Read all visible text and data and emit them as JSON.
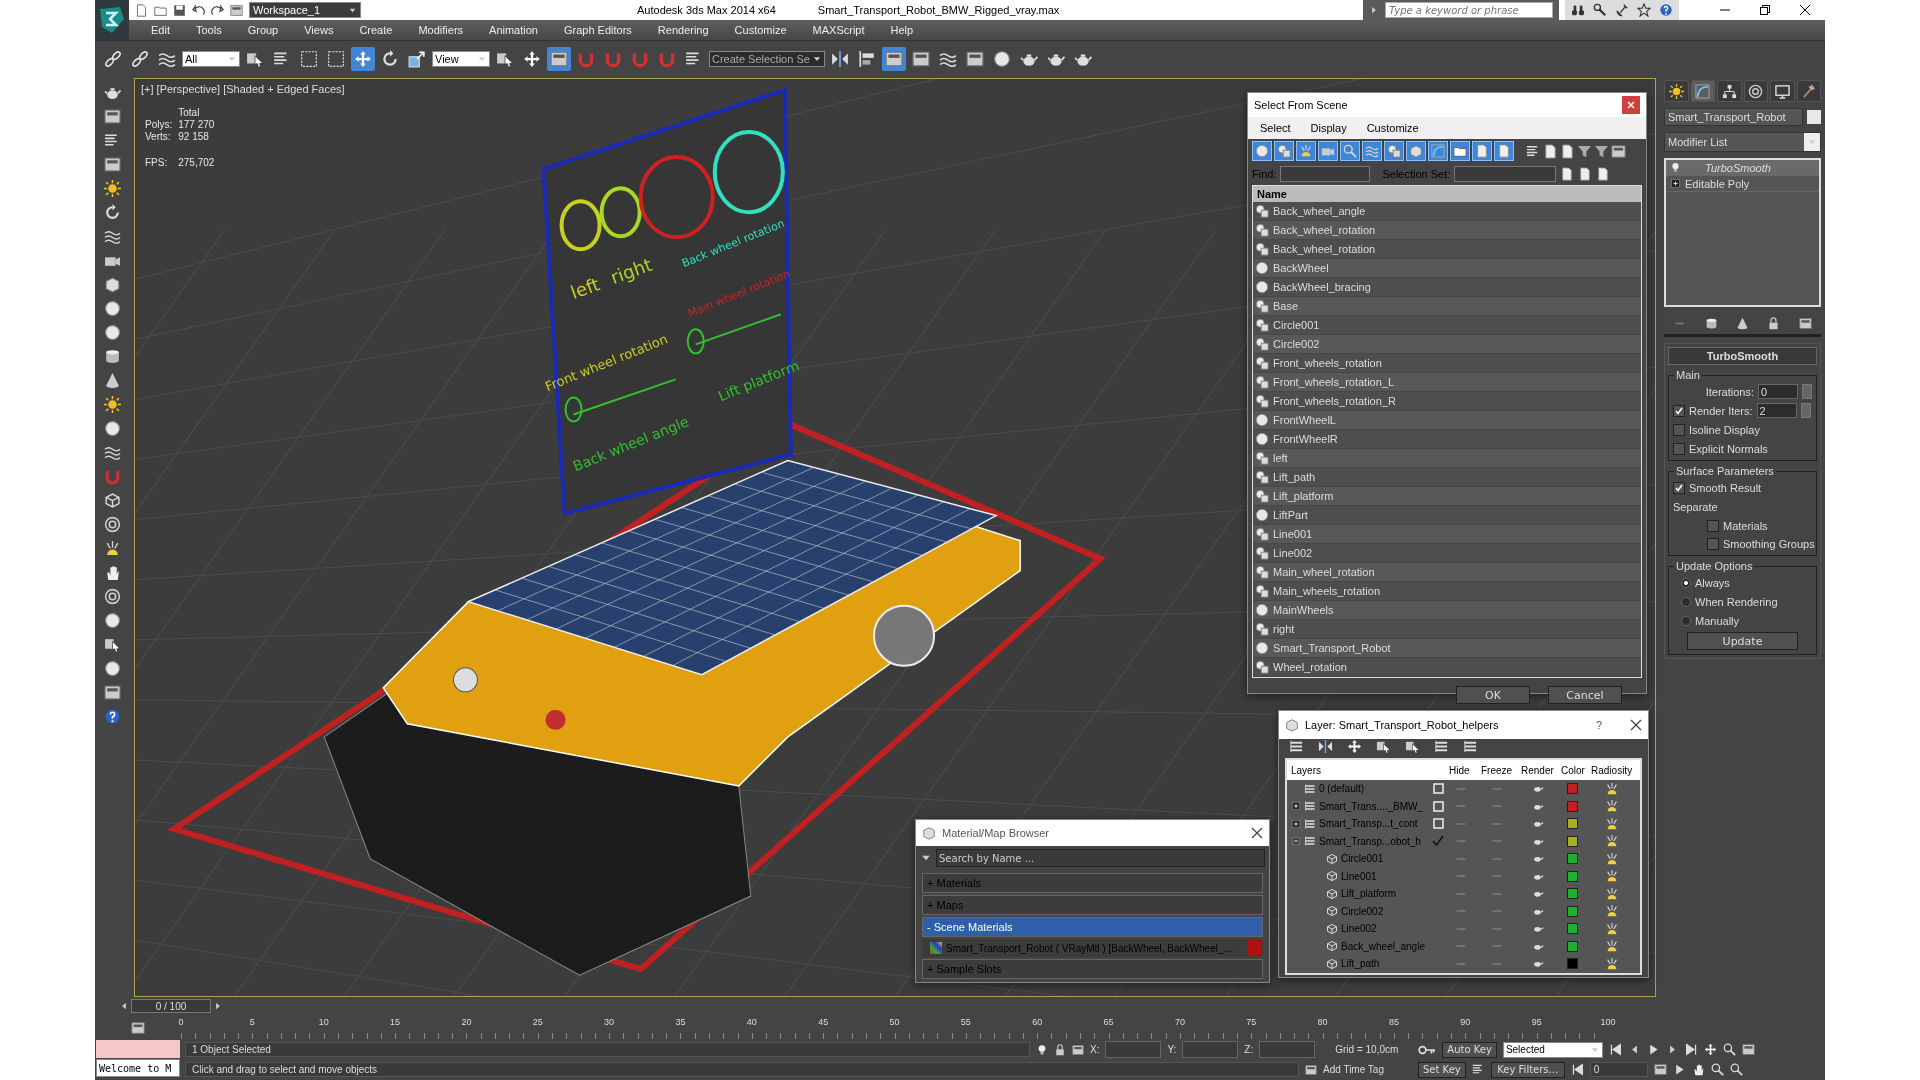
{
  "title_bar": {
    "workspace": "Workspace_1",
    "app": "Autodesk 3ds Max  2014 x64",
    "file": "Smart_Transport_Robot_BMW_Rigged_vray.max",
    "search": {
      "placeholder": "Type a keyword or phrase"
    }
  },
  "menu": [
    "Edit",
    "Tools",
    "Group",
    "Views",
    "Create",
    "Modifiers",
    "Animation",
    "Graph Editors",
    "Rendering",
    "Customize",
    "MAXScript",
    "Help"
  ],
  "toolbar": [
    {
      "kind": "button",
      "selected": false
    },
    {
      "kind": "button",
      "selected": false
    },
    {
      "kind": "button",
      "selected": false
    },
    {
      "kind": "dropdown",
      "value": "All"
    },
    {
      "kind": "button",
      "selected": false
    },
    {
      "kind": "button",
      "selected": false
    },
    {
      "kind": "button",
      "selected": false
    },
    {
      "kind": "button",
      "selected": false
    },
    {
      "kind": "button",
      "selected": true
    },
    {
      "kind": "button",
      "selected": false
    },
    {
      "kind": "button",
      "selected": false
    },
    {
      "kind": "dropdown",
      "value": "View"
    },
    {
      "kind": "button",
      "selected": false
    },
    {
      "kind": "button",
      "selected": false
    },
    {
      "kind": "button",
      "selected": true
    },
    {
      "kind": "button",
      "selected": false
    },
    {
      "kind": "button",
      "selected": false
    },
    {
      "kind": "button",
      "selected": false
    },
    {
      "kind": "button",
      "selected": false
    },
    {
      "kind": "button",
      "selected": false
    },
    {
      "kind": "dropdown",
      "value": "Create Selection Se"
    },
    {
      "kind": "button",
      "selected": false
    },
    {
      "kind": "button",
      "selected": false
    },
    {
      "kind": "button",
      "selected": true
    },
    {
      "kind": "button",
      "selected": false
    },
    {
      "kind": "button",
      "selected": false
    },
    {
      "kind": "button",
      "selected": false
    },
    {
      "kind": "button",
      "selected": false
    },
    {
      "kind": "button",
      "selected": false
    },
    {
      "kind": "button",
      "selected": false
    },
    {
      "kind": "button",
      "selected": false
    }
  ],
  "viewport": {
    "label": "[+] [Perspective] [Shaded + Edged Faces]",
    "stats_header": "Total",
    "stats": [
      {
        "label": "Polys:",
        "value": "177 270"
      },
      {
        "label": "Verts:",
        "value": "92 158"
      },
      {
        "label": "FPS:",
        "value": "275,702"
      }
    ],
    "board_labels": [
      {
        "text": "left",
        "color": "#c8d020"
      },
      {
        "text": "right",
        "color": "#a8d820"
      },
      {
        "text": "Front wheel rotation",
        "color": "#c8d020"
      },
      {
        "text": "Main wheel rotation",
        "color": "#d02020"
      },
      {
        "text": "Back wheel rotation",
        "color": "#30e0c0"
      },
      {
        "text": "Lift platform",
        "color": "#30c030"
      },
      {
        "text": "Back wheel angle",
        "color": "#30c030"
      }
    ]
  },
  "command_panel": {
    "tabs": [
      {
        "selected": false
      },
      {
        "selected": true
      },
      {
        "selected": false
      },
      {
        "selected": false
      },
      {
        "selected": false
      },
      {
        "selected": false
      }
    ],
    "object_name": "Smart_Transport_Robot",
    "modifier_list": "Modifier List",
    "stack": [
      {
        "label": "TurboSmooth",
        "kind": "modifier",
        "selected": true
      },
      {
        "label": "Editable Poly",
        "kind": "base",
        "selected": false
      }
    ],
    "rollout_title": "TurboSmooth",
    "groups": [
      {
        "title": "Main",
        "items": [
          {
            "kind": "spinner",
            "label": "Iterations:",
            "value": "0"
          },
          {
            "kind": "checked_spinner",
            "label": "Render Iters:",
            "value": "2",
            "checked": true
          },
          {
            "kind": "checkbox",
            "label": "Isoline Display",
            "checked": false
          },
          {
            "kind": "checkbox",
            "label": "Explicit Normals",
            "checked": false
          }
        ]
      },
      {
        "title": "Surface Parameters",
        "items": [
          {
            "kind": "checkbox",
            "label": "Smooth Result",
            "checked": true
          },
          {
            "kind": "section",
            "label": "Separate",
            "children": [
              {
                "kind": "checkbox",
                "label": "Materials",
                "checked": false
              },
              {
                "kind": "checkbox",
                "label": "Smoothing Groups",
                "checked": false
              }
            ]
          }
        ]
      },
      {
        "title": "Update Options",
        "items": [
          {
            "kind": "radio",
            "label": "Always",
            "selected": true
          },
          {
            "kind": "radio",
            "label": "When Rendering",
            "selected": false
          },
          {
            "kind": "radio",
            "label": "Manually",
            "selected": false
          },
          {
            "kind": "button",
            "label": "Update"
          }
        ]
      }
    ]
  },
  "select_dialog": {
    "title": "Select From Scene",
    "menu": [
      "Select",
      "Display",
      "Customize"
    ],
    "filters": [
      {
        "on": true
      },
      {
        "on": true
      },
      {
        "on": true
      },
      {
        "on": true
      },
      {
        "on": true
      },
      {
        "on": true
      },
      {
        "on": true
      },
      {
        "on": true
      },
      {
        "on": true
      },
      {
        "on": true
      },
      {
        "on": true
      },
      {
        "on": true
      }
    ],
    "find_label": "Find:",
    "set_label": "Selection Set:",
    "column": "Name",
    "rows": [
      {
        "name": "Back_wheel_angle",
        "kind": "shape"
      },
      {
        "name": "Back_wheel_rotation",
        "kind": "shape"
      },
      {
        "name": "Back_wheel_rotation",
        "kind": "shape"
      },
      {
        "name": "BackWheel",
        "kind": "geometry"
      },
      {
        "name": "BackWheel_bracing",
        "kind": "geometry"
      },
      {
        "name": "Base",
        "kind": "shape"
      },
      {
        "name": "Circle001",
        "kind": "shape"
      },
      {
        "name": "Circle002",
        "kind": "shape"
      },
      {
        "name": "Front_wheels_rotation",
        "kind": "shape"
      },
      {
        "name": "Front_wheels_rotation_L",
        "kind": "shape"
      },
      {
        "name": "Front_wheels_rotation_R",
        "kind": "shape"
      },
      {
        "name": "FrontWheelL",
        "kind": "geometry"
      },
      {
        "name": "FrontWheelR",
        "kind": "geometry"
      },
      {
        "name": "left",
        "kind": "shape"
      },
      {
        "name": "Lift_path",
        "kind": "shape"
      },
      {
        "name": "Lift_platform",
        "kind": "shape"
      },
      {
        "name": "LiftPart",
        "kind": "geometry"
      },
      {
        "name": "Line001",
        "kind": "shape"
      },
      {
        "name": "Line002",
        "kind": "shape"
      },
      {
        "name": "Main_wheel_rotation",
        "kind": "shape"
      },
      {
        "name": "Main_wheels_rotation",
        "kind": "shape"
      },
      {
        "name": "MainWheels",
        "kind": "geometry"
      },
      {
        "name": "right",
        "kind": "shape"
      },
      {
        "name": "Smart_Transport_Robot",
        "kind": "geometry"
      },
      {
        "name": "Wheel_rotation",
        "kind": "shape"
      }
    ],
    "buttons": [
      "OK",
      "Cancel"
    ]
  },
  "layer_dialog": {
    "title": "Layer: Smart_Transport_Robot_helpers",
    "help": "?",
    "columns": [
      "Layers",
      "Hide",
      "Freeze",
      "Render",
      "Color",
      "Radiosity"
    ],
    "rows": [
      {
        "name": "0 (default)",
        "current": false,
        "color": "#c02020"
      },
      {
        "name": "Smart_Trans...._BMW_",
        "current": false,
        "expanded": false,
        "color": "#c02020"
      },
      {
        "name": "Smart_Transp...t_cont",
        "current": false,
        "expanded": false,
        "color": "#a8b020"
      },
      {
        "name": "Smart_Transp...obot_h",
        "current": true,
        "expanded": true,
        "color": "#a8b020",
        "children": [
          {
            "name": "Circle001",
            "color": "#20b030"
          },
          {
            "name": "Line001",
            "color": "#20b030"
          },
          {
            "name": "Lift_platform",
            "color": "#20b030"
          },
          {
            "name": "Circle002",
            "color": "#20b030"
          },
          {
            "name": "Line002",
            "color": "#20b030"
          },
          {
            "name": "Back_wheel_angle",
            "color": "#20b030"
          },
          {
            "name": "Lift_path",
            "color": "#000000"
          }
        ]
      }
    ]
  },
  "material_browser": {
    "title": "Material/Map Browser",
    "search": {
      "placeholder": "Search by Name ..."
    },
    "groups": [
      {
        "label": "+ Materials",
        "selected": false
      },
      {
        "label": "+ Maps",
        "selected": false
      },
      {
        "label": "- Scene Materials",
        "selected": true,
        "items": [
          "Smart_Transport_Robot ( VRayMtl ) [BackWheel, BackWheel_..."
        ]
      },
      {
        "label": "+ Sample Slots",
        "selected": false
      }
    ]
  },
  "timeline": {
    "position": "0 / 100",
    "ticks": [
      "0",
      "5",
      "10",
      "15",
      "20",
      "25",
      "30",
      "35",
      "40",
      "45",
      "50",
      "55",
      "60",
      "65",
      "70",
      "75",
      "80",
      "85",
      "90",
      "95",
      "100"
    ]
  },
  "status": {
    "listener": "Welcome to M",
    "selection": "1 Object Selected",
    "prompt": "Click and drag to select and move objects",
    "coords": [
      "X:",
      "Y:",
      "Z:"
    ],
    "grid": "Grid = 10,0cm",
    "add_time_tag": "Add Time Tag",
    "auto_key": "Auto Key",
    "key_mode": "Selected",
    "set_key": "Set Key",
    "key_filters": "Key Filters...",
    "frame": "0"
  }
}
